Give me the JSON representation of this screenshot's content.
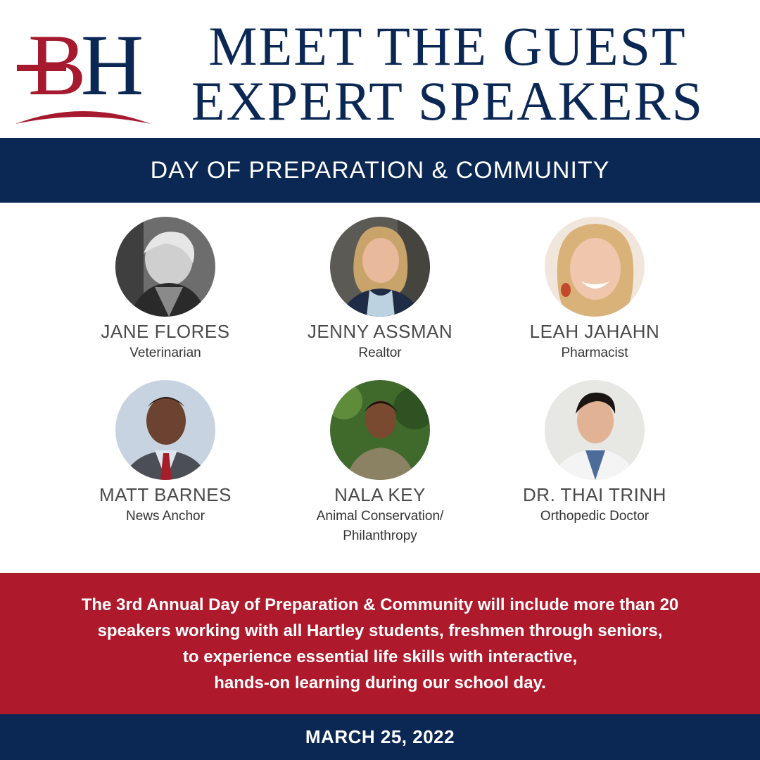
{
  "logo": {
    "letters": "BH"
  },
  "title": {
    "line1": "MEET THE GUEST",
    "line2": "EXPERT SPEAKERS"
  },
  "banner": {
    "text": "DAY OF PREPARATION & COMMUNITY"
  },
  "speakers": [
    {
      "name": "JANE FLORES",
      "role": "Veterinarian"
    },
    {
      "name": "JENNY ASSMAN",
      "role": "Realtor"
    },
    {
      "name": "LEAH JAHAHN",
      "role": "Pharmacist"
    },
    {
      "name": "MATT BARNES",
      "role": "News Anchor"
    },
    {
      "name": "NALA KEY",
      "role": "Animal Conservation/",
      "role2": "Philanthropy"
    },
    {
      "name": "DR. THAI TRINH",
      "role": "Orthopedic Doctor"
    }
  ],
  "info": {
    "lines": [
      "The 3rd Annual Day of Preparation & Community will include more than 20",
      "speakers working with all Hartley students, freshmen through seniors,",
      "to experience essential life skills with interactive,",
      "hands-on learning during our school day."
    ]
  },
  "footer": {
    "date": "MARCH 25, 2022"
  },
  "colors": {
    "navy": "#0b2855",
    "red": "#ae1a2c",
    "text_gray": "#4a4a4a"
  }
}
